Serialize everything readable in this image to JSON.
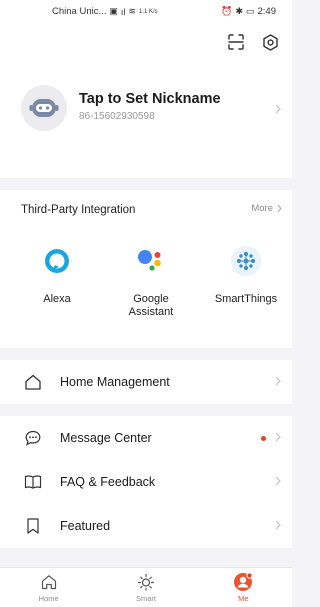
{
  "status_bar": {
    "carrier": "China Unic...",
    "network": "1.1 K/s",
    "time": "2:49"
  },
  "header": {
    "scan_icon": "scan-icon",
    "settings_icon": "settings-icon"
  },
  "profile": {
    "name": "Tap to Set Nickname",
    "phone": "86-15602930598"
  },
  "integration": {
    "title": "Third-Party Integration",
    "more_label": "More",
    "items": [
      {
        "label": "Alexa",
        "icon": "alexa-icon"
      },
      {
        "label": "Google\nAssistant",
        "icon": "google-assistant-icon"
      },
      {
        "label": "SmartThings",
        "icon": "smartthings-icon"
      }
    ]
  },
  "menu": {
    "home_management": "Home Management",
    "message_center": "Message Center",
    "faq_feedback": "FAQ & Feedback",
    "featured": "Featured"
  },
  "bottom_nav": {
    "home": "Home",
    "smart": "Smart",
    "me": "Me"
  },
  "colors": {
    "accent": "#e8552c",
    "badge": "#e8401f"
  }
}
